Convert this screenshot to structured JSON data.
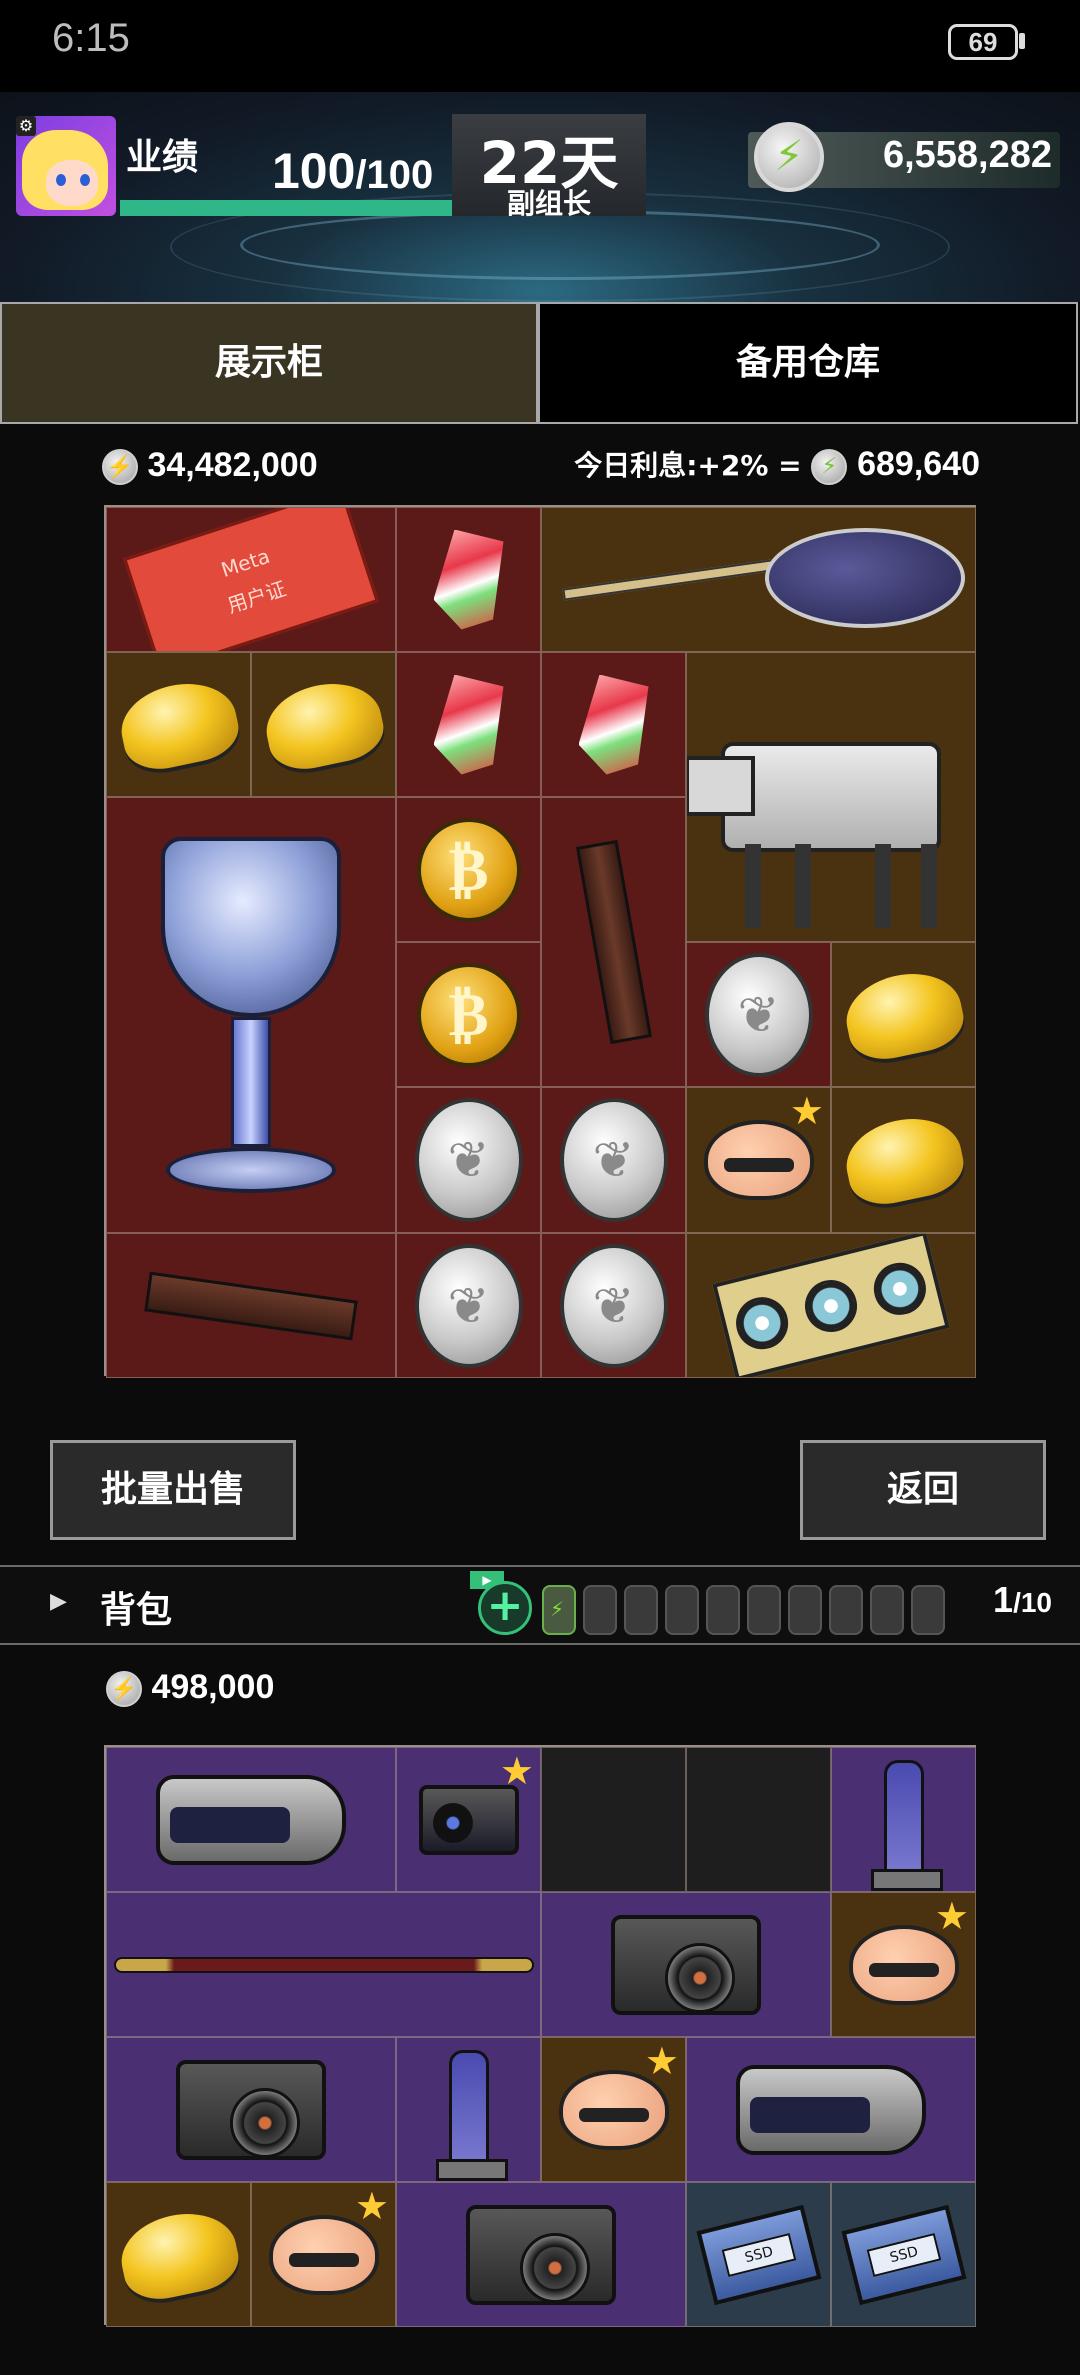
{
  "status_bar": {
    "time": "6:15",
    "battery": "69"
  },
  "hud": {
    "perf_label": "业绩",
    "perf_current": "100",
    "perf_max": "/100",
    "perf_fraction": 1.0,
    "days": "22天",
    "rank": "副组长",
    "coins_total": "6,558,282"
  },
  "tabs": {
    "display": "展示柜",
    "storage": "备用仓库"
  },
  "display_case": {
    "value": "34,482,000",
    "interest_label": "今日利息:+2% =",
    "interest_value": "689,640",
    "card_logo": "Meta",
    "card_text": "用户证"
  },
  "buttons": {
    "bulk_sell": "批量出售",
    "back": "返回"
  },
  "backpack": {
    "label": "背包",
    "count_current": "1",
    "count_max": "/10",
    "value": "498,000",
    "ssd_label": "SSD"
  },
  "colors": {
    "tab_active": "#3a3423",
    "cell_red": "#5b1a17",
    "cell_brown": "#4a3210",
    "cell_purple": "#4a2f73",
    "accent_green": "#35c07a",
    "star": "#ffcc33"
  }
}
